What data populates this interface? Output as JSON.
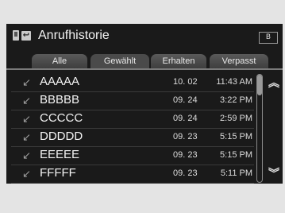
{
  "header": {
    "title": "Anrufhistorie",
    "back_icon": "back-arrow-icon",
    "phone_icon": "phone-icon",
    "status": "B",
    "status_icon": "bluetooth-signal-icon"
  },
  "tabs": [
    {
      "label": "Alle",
      "active": false
    },
    {
      "label": "Gewählt",
      "active": true
    },
    {
      "label": "Erhalten",
      "active": false
    },
    {
      "label": "Verpasst",
      "active": false
    }
  ],
  "calls": [
    {
      "name": "AAAAA",
      "date": "10. 02",
      "time": "11:43 AM"
    },
    {
      "name": "BBBBB",
      "date": "09. 24",
      "time": "3:22 PM"
    },
    {
      "name": "CCCCC",
      "date": "09. 24",
      "time": "2:59 PM"
    },
    {
      "name": "DDDDD",
      "date": "09. 23",
      "time": "5:15 PM"
    },
    {
      "name": "EEEEE",
      "date": "09. 23",
      "time": "5:15 PM"
    },
    {
      "name": "FFFFF",
      "date": "09. 23",
      "time": "5:11 PM"
    }
  ],
  "scroll": {
    "up_icon": "double-chevron-up-icon",
    "down_icon": "double-chevron-down-icon"
  }
}
